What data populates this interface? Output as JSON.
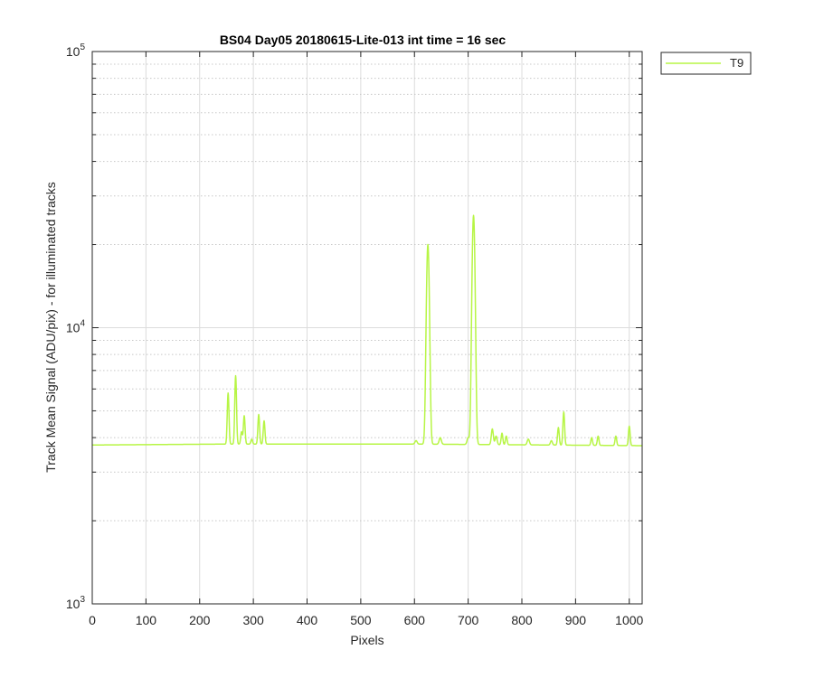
{
  "chart_data": {
    "type": "line",
    "title": "BS04 Day05 20180615-Lite-013 int time = 16 sec",
    "xlabel": "Pixels",
    "ylabel": "Track Mean Signal (ADU/pix) - for illuminated tracks",
    "xlim": [
      0,
      1024
    ],
    "ylim": [
      1000,
      100000
    ],
    "yscale": "log",
    "grid": true,
    "x_ticks": [
      0,
      100,
      200,
      300,
      400,
      500,
      600,
      700,
      800,
      900,
      1000
    ],
    "y_ticks": [
      {
        "value": 1000,
        "base": "10",
        "exp": "3"
      },
      {
        "value": 10000,
        "base": "10",
        "exp": "4"
      },
      {
        "value": 100000,
        "base": "10",
        "exp": "5"
      }
    ],
    "legend": {
      "placement": "outside-top-right"
    },
    "series": [
      {
        "name": "T9",
        "color": "#b7f545",
        "baseline": [
          [
            0,
            3760
          ],
          [
            250,
            3790
          ],
          [
            600,
            3790
          ],
          [
            1024,
            3740
          ]
        ],
        "peaks": [
          [
            253,
            5800,
            1.5
          ],
          [
            267,
            6700,
            1.5
          ],
          [
            278,
            4200,
            1.5
          ],
          [
            283,
            4800,
            1.5
          ],
          [
            297,
            3950,
            1.5
          ],
          [
            310,
            4850,
            1.5
          ],
          [
            320,
            4600,
            1.5
          ],
          [
            603,
            3900,
            2
          ],
          [
            625,
            20000,
            2.5
          ],
          [
            648,
            4000,
            2
          ],
          [
            700,
            4000,
            2
          ],
          [
            710,
            25500,
            2.5
          ],
          [
            745,
            4300,
            1.8
          ],
          [
            752,
            4050,
            1.8
          ],
          [
            763,
            4150,
            1.5
          ],
          [
            771,
            4050,
            1.5
          ],
          [
            812,
            3950,
            2
          ],
          [
            855,
            3900,
            1.8
          ],
          [
            868,
            4350,
            1.5
          ],
          [
            878,
            4950,
            1.5
          ],
          [
            930,
            4000,
            1.5
          ],
          [
            942,
            4050,
            1.5
          ],
          [
            975,
            4050,
            1.5
          ],
          [
            1000,
            4400,
            1.5
          ]
        ]
      }
    ]
  }
}
